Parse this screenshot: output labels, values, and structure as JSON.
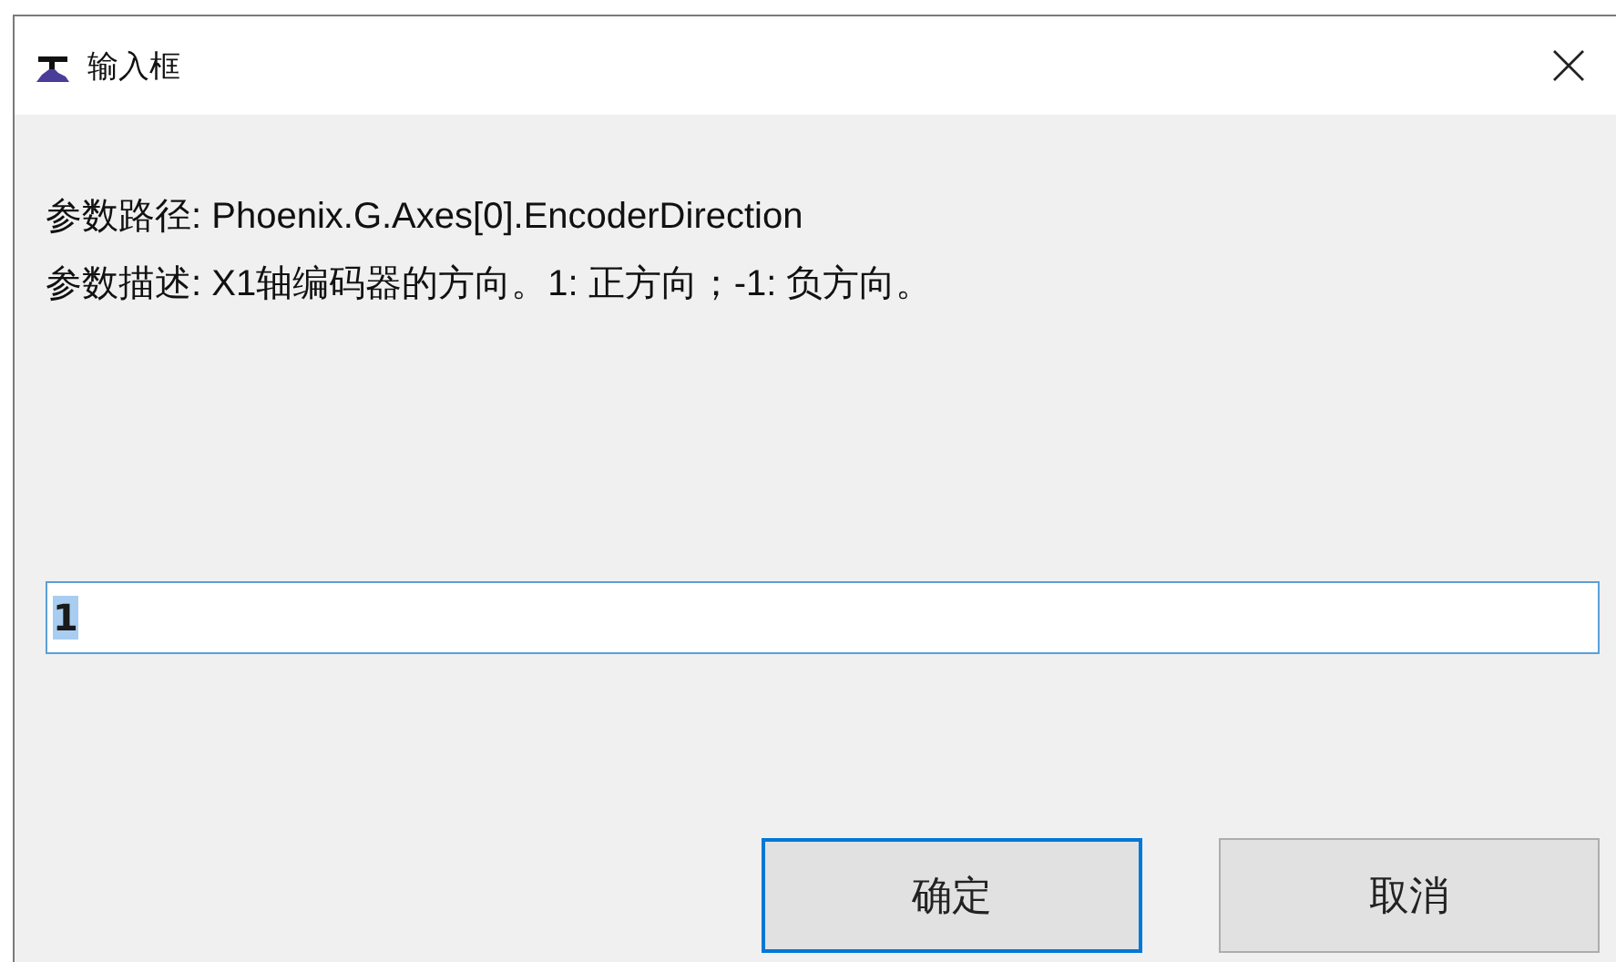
{
  "window": {
    "title": "输入框"
  },
  "lines": [
    "参数路径: Phoenix.G.Axes[0].EncoderDirection",
    "参数描述: X1轴编码器的方向。1: 正方向；-1: 负方向。"
  ],
  "input": {
    "value": "1",
    "text_selected": true
  },
  "buttons": [
    {
      "label": "确定",
      "default": true
    },
    {
      "label": "取消",
      "default": false
    }
  ]
}
